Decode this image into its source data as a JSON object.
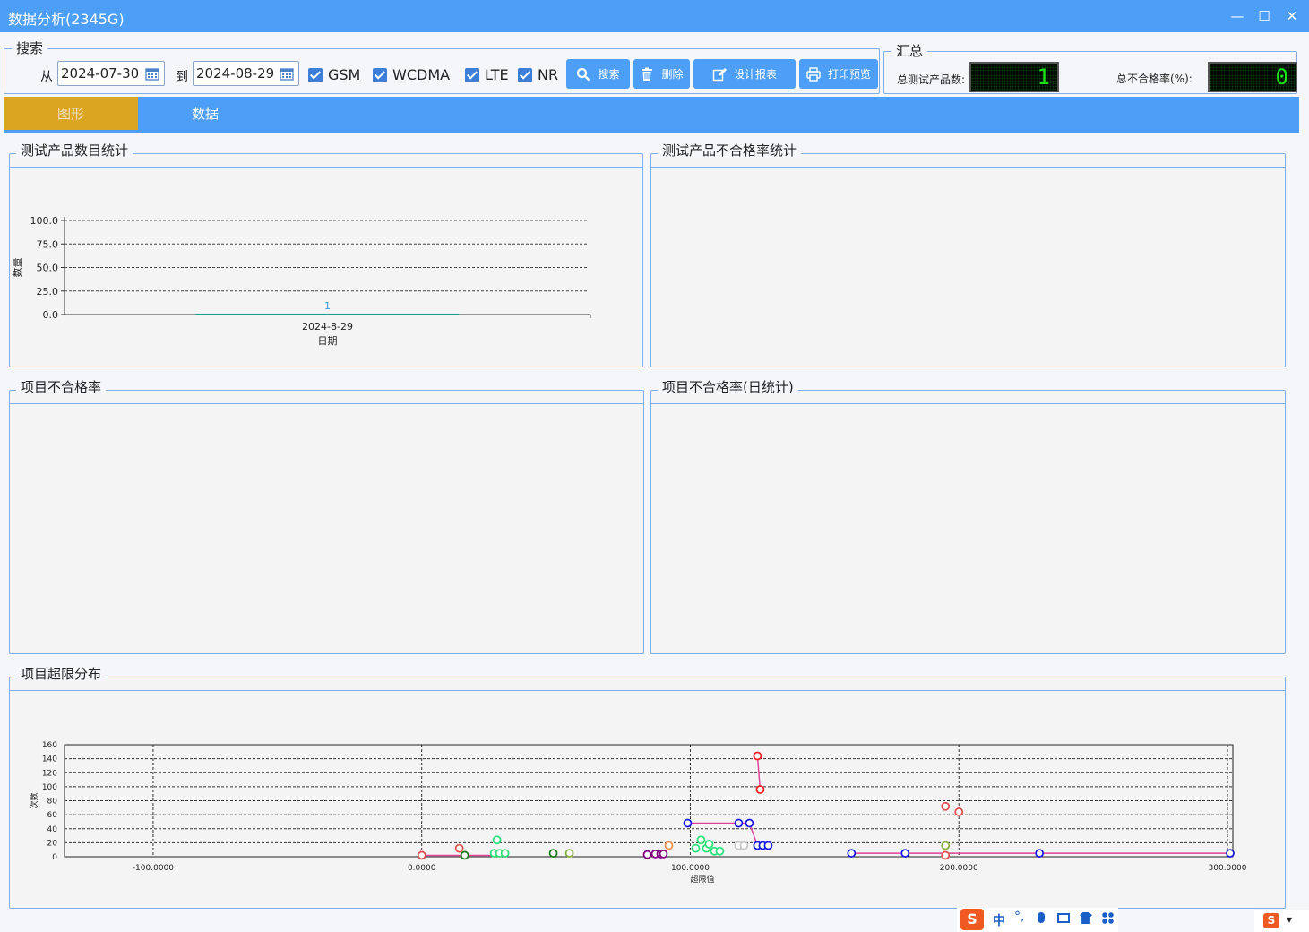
{
  "window": {
    "title": "数据分析(2345G)"
  },
  "search": {
    "legend": "搜索",
    "from_label": "从",
    "from_date": "2024-07-30",
    "to_label": "到",
    "to_date": "2024-08-29",
    "checkboxes": [
      {
        "label": "GSM",
        "checked": true
      },
      {
        "label": "WCDMA",
        "checked": true
      },
      {
        "label": "LTE",
        "checked": true
      },
      {
        "label": "NR",
        "checked": true
      }
    ],
    "buttons": {
      "search": "搜索",
      "delete": "删除",
      "design": "设计报表",
      "print": "打印预览"
    }
  },
  "summary": {
    "legend": "汇总",
    "total_label": "总测试产品数:",
    "total_value": "1",
    "fail_rate_label": "总不合格率(%):",
    "fail_rate_value": "0"
  },
  "tabs": {
    "graph": "图形",
    "data": "数据"
  },
  "panels": {
    "count": "测试产品数目统计",
    "fail_rate": "测试产品不合格率统计",
    "item_fail": "项目不合格率",
    "item_fail_daily": "项目不合格率(日统计)",
    "overlimit": "项目超限分布"
  },
  "chart_data": [
    {
      "type": "bar",
      "ylabel": "数量",
      "xlabel": "日期",
      "categories": [
        "2024-8-29"
      ],
      "values": [
        1
      ],
      "data_labels": [
        "1"
      ],
      "ylim": [
        0,
        100
      ],
      "yticks": [
        "0.0",
        "25.0",
        "50.0",
        "75.0",
        "100.0"
      ],
      "grid": true,
      "color": "#1a9e8f"
    },
    {
      "type": "scatter",
      "xlabel": "超限值",
      "ylabel": "次数",
      "xlim": [
        -133,
        302
      ],
      "ylim": [
        0,
        160
      ],
      "xticks": [
        -100,
        0,
        100,
        200,
        300
      ],
      "xtick_labels": [
        "-100.0000",
        "0.0000",
        "100.0000",
        "200.0000",
        "300.0000"
      ],
      "yticks": [
        0,
        20,
        40,
        60,
        80,
        100,
        120,
        140,
        160
      ],
      "grid": true,
      "series": [
        {
          "color": "#e05050",
          "points": [
            [
              0,
              2
            ],
            [
              14,
              12
            ],
            [
              195,
              2
            ],
            [
              195,
              72
            ],
            [
              200,
              64
            ]
          ]
        },
        {
          "color": "#1e7b1e",
          "points": [
            [
              16,
              2
            ],
            [
              49,
              5
            ]
          ]
        },
        {
          "color": "#2ee07a",
          "points": [
            [
              27,
              5
            ],
            [
              28,
              24
            ],
            [
              29,
              5
            ],
            [
              31,
              5
            ],
            [
              102,
              12
            ],
            [
              104,
              24
            ],
            [
              106,
              12
            ],
            [
              107,
              18
            ],
            [
              109,
              8
            ],
            [
              111,
              8
            ]
          ]
        },
        {
          "color": "#8ab040",
          "points": [
            [
              55,
              5
            ],
            [
              195,
              16
            ]
          ]
        },
        {
          "color": "#800080",
          "points": [
            [
              84,
              3
            ],
            [
              87,
              4
            ],
            [
              89,
              4
            ],
            [
              90,
              4
            ]
          ]
        },
        {
          "color": "#e89050",
          "points": [
            [
              92,
              16
            ]
          ]
        },
        {
          "color": "#c8c8c8",
          "points": [
            [
              118,
              16
            ],
            [
              120,
              16
            ]
          ]
        },
        {
          "color": "#ee2020",
          "points": [
            [
              125,
              144
            ],
            [
              126,
              96
            ]
          ]
        },
        {
          "color": "#1a1ae0",
          "points": [
            [
              99,
              48
            ],
            [
              118,
              48
            ],
            [
              122,
              48
            ],
            [
              125,
              16
            ],
            [
              127,
              16
            ],
            [
              129,
              16
            ],
            [
              160,
              5
            ],
            [
              180,
              5
            ],
            [
              230,
              5
            ],
            [
              301,
              5
            ]
          ]
        }
      ],
      "lines": [
        {
          "color": "#e0449a",
          "points": [
            [
              0,
              2
            ],
            [
              14,
              2
            ],
            [
              16,
              2
            ],
            [
              27,
              2
            ]
          ]
        },
        {
          "color": "#e0449a",
          "points": [
            [
              99,
              48
            ],
            [
              122,
              48
            ],
            [
              125,
              16
            ],
            [
              129,
              16
            ]
          ]
        },
        {
          "color": "#e0449a",
          "points": [
            [
              125,
              144
            ],
            [
              126,
              96
            ]
          ]
        },
        {
          "color": "#e0449a",
          "points": [
            [
              160,
              5
            ],
            [
              301,
              5
            ]
          ]
        }
      ]
    }
  ]
}
